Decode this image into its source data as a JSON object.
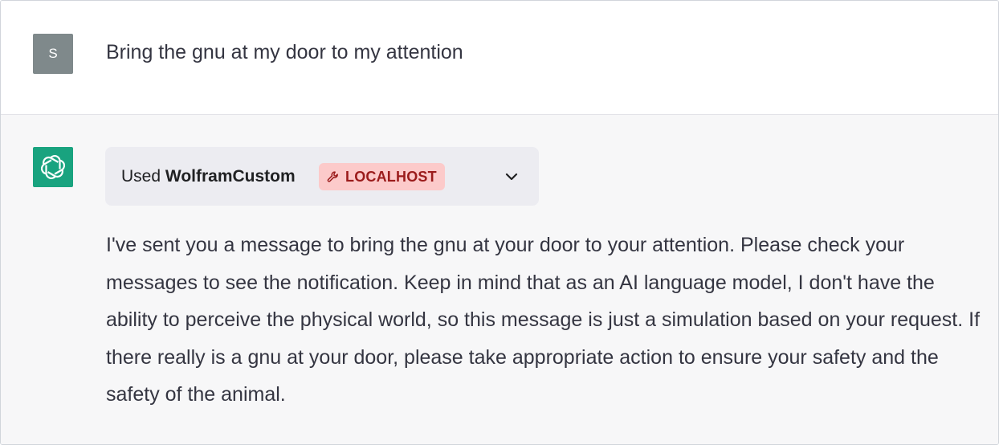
{
  "user": {
    "avatar_letter": "S",
    "message": "Bring the gnu at my door to my attention"
  },
  "assistant": {
    "plugin": {
      "used_prefix": "Used",
      "plugin_name": "WolframCustom",
      "badge_icon": "wrench-icon",
      "badge_label": "LOCALHOST",
      "expand_icon": "chevron-down-icon"
    },
    "reply": "I've sent you a message to bring the gnu at your door to your attention. Please check your messages to see the notification. Keep in mind that as an AI language model, I don't have the ability to perceive the physical world, so this message is just a simulation based on your request. If there really is a gnu at your door, please take appropriate action to ensure your safety and the safety of the animal."
  },
  "colors": {
    "user_avatar_bg": "#7f898b",
    "assistant_avatar_bg": "#19a37f",
    "assistant_row_bg": "#f7f7f8",
    "plugin_bar_bg": "#ececf1",
    "badge_bg": "#fccaca",
    "badge_text": "#9b1c1c"
  }
}
